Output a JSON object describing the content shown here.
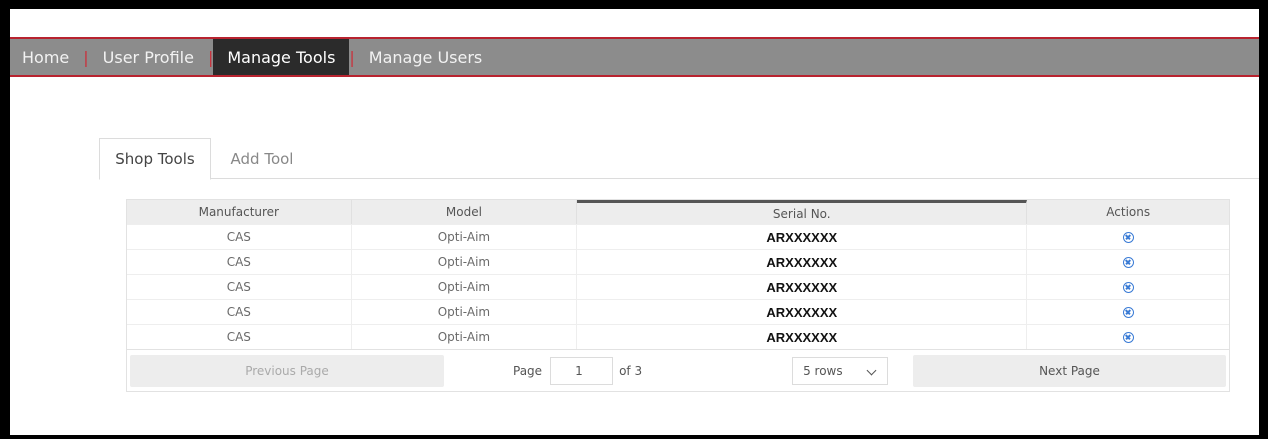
{
  "nav": {
    "items": [
      {
        "label": "Home",
        "active": false
      },
      {
        "label": "User Profile",
        "active": false
      },
      {
        "label": "Manage Tools",
        "active": true
      },
      {
        "label": "Manage Users",
        "active": false
      }
    ],
    "separator": "|"
  },
  "tabs": [
    {
      "label": "Shop Tools",
      "active": true
    },
    {
      "label": "Add Tool",
      "active": false
    }
  ],
  "table": {
    "columns": [
      "Manufacturer",
      "Model",
      "Serial No.",
      "Actions"
    ],
    "rows": [
      {
        "manufacturer": "CAS",
        "model": "Opti-Aim",
        "serial": "ARXXXXXX",
        "action_icon": "remove-circle-icon"
      },
      {
        "manufacturer": "CAS",
        "model": "Opti-Aim",
        "serial": "ARXXXXXX",
        "action_icon": "remove-circle-icon"
      },
      {
        "manufacturer": "CAS",
        "model": "Opti-Aim",
        "serial": "ARXXXXXX",
        "action_icon": "remove-circle-icon"
      },
      {
        "manufacturer": "CAS",
        "model": "Opti-Aim",
        "serial": "ARXXXXXX",
        "action_icon": "remove-circle-icon"
      },
      {
        "manufacturer": "CAS",
        "model": "Opti-Aim",
        "serial": "ARXXXXXX",
        "action_icon": "remove-circle-icon"
      }
    ]
  },
  "pager": {
    "prev_label": "Previous Page",
    "page_label": "Page",
    "page_value": "1",
    "of_label": "of 3",
    "rows_value": "5 rows",
    "next_label": "Next Page"
  },
  "colors": {
    "nav_bg": "#8c8c8c",
    "nav_active": "#2b2b2b",
    "accent": "#b8232f",
    "action_icon": "#3a7bd5"
  }
}
